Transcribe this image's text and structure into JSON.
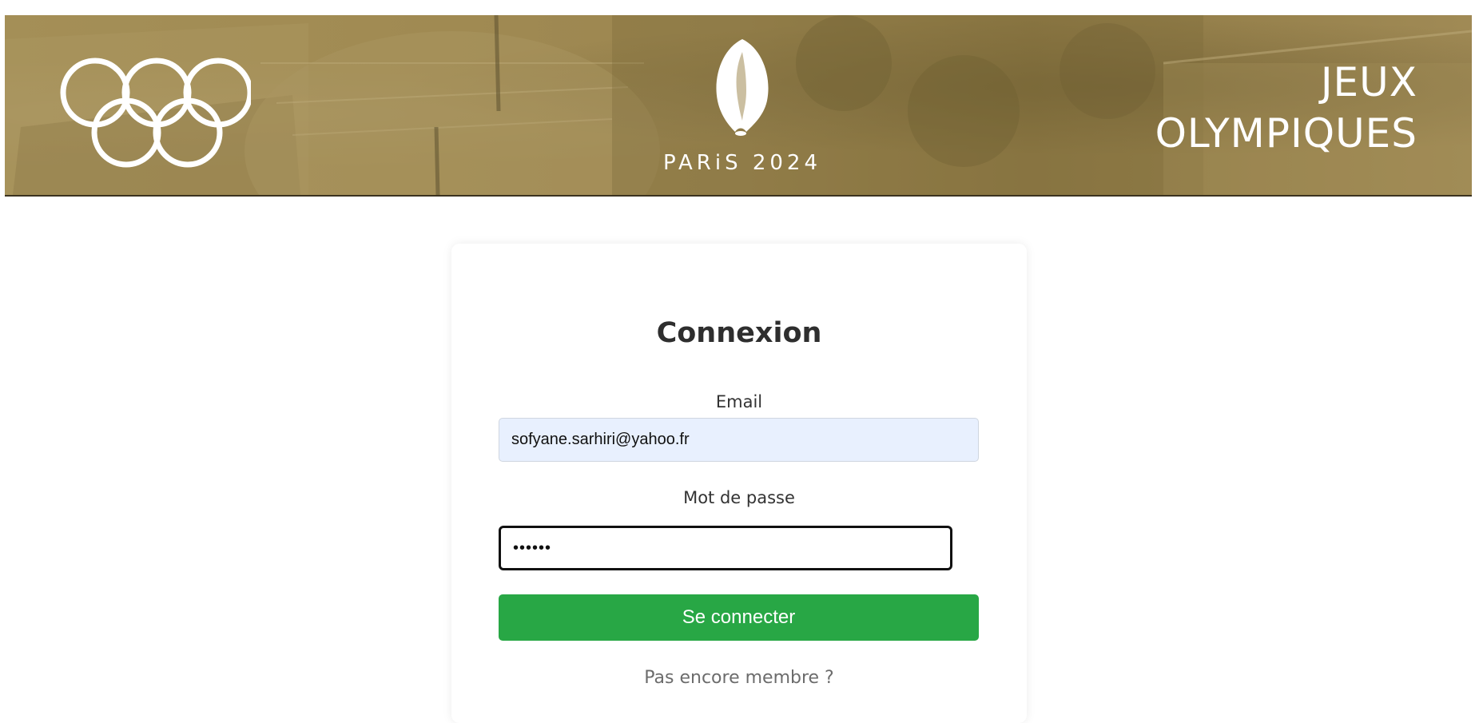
{
  "banner": {
    "left_logo": "olympic-rings",
    "center_logo": "paris-2024-flame-emblem",
    "center_text": "PARiS 2024",
    "right_text_line1": "JEUX",
    "right_text_line2": "OLYMPIQUES",
    "tint_color": "#a18b53"
  },
  "login": {
    "title": "Connexion",
    "email_label": "Email",
    "email_value": "sofyane.sarhiri@yahoo.fr",
    "password_label": "Mot de passe",
    "password_value": "••••••",
    "submit_label": "Se connecter",
    "signup_text": "Pas encore membre ?",
    "button_color": "#28a745",
    "email_bg_color": "#e8f0fe"
  }
}
